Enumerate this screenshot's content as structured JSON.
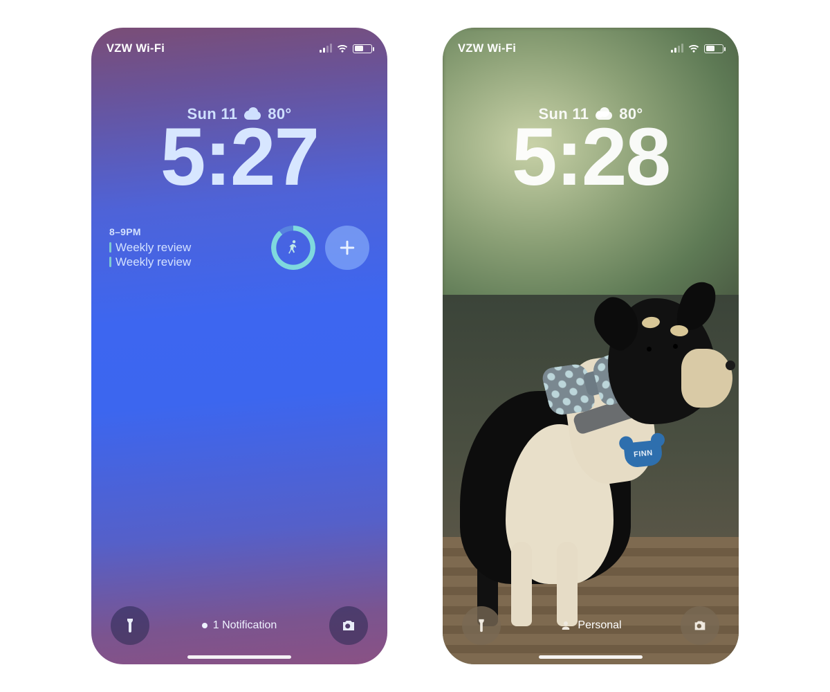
{
  "left": {
    "status": {
      "carrier": "VZW Wi-Fi"
    },
    "date": "Sun 11",
    "temp": "80°",
    "time": "5:27",
    "calendar": {
      "time_range": "8–9PM",
      "events": [
        "Weekly review",
        "Weekly review"
      ]
    },
    "notification_text": "1 Notification"
  },
  "right": {
    "status": {
      "carrier": "VZW Wi-Fi"
    },
    "date": "Sun 11",
    "temp": "80°",
    "time": "5:28",
    "focus_label": "Personal",
    "dog_tag": "FINN"
  }
}
